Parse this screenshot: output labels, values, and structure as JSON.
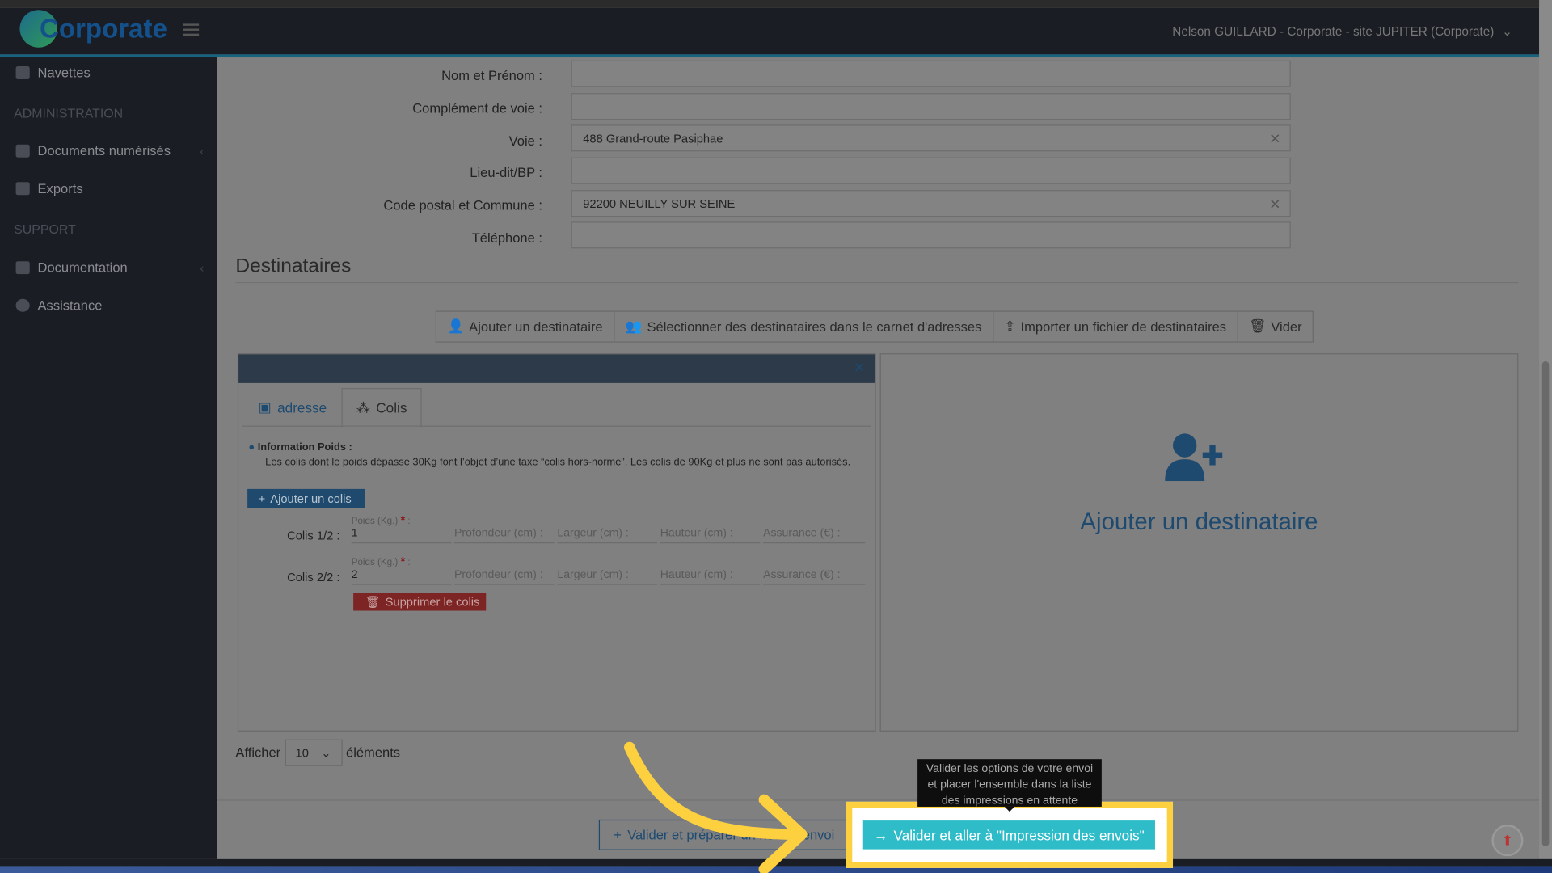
{
  "header": {
    "logo_text": "Corporate",
    "user": "Nelson GUILLARD - Corporate - site JUPITER (Corporate)"
  },
  "sidebar": {
    "items": [
      {
        "label": "Navettes",
        "icon": "truck-icon"
      },
      {
        "label": "Documents numérisés",
        "icon": "qrcode-icon"
      },
      {
        "label": "Exports",
        "icon": "download-icon"
      },
      {
        "label": "Documentation",
        "icon": "book-icon"
      },
      {
        "label": "Assistance",
        "icon": "question-icon"
      }
    ],
    "sections": [
      "ADMINISTRATION",
      "SUPPORT"
    ]
  },
  "form": {
    "fields": [
      {
        "label": "Nom et Prénom :",
        "value": ""
      },
      {
        "label": "Complément de voie :",
        "value": ""
      },
      {
        "label": "Voie :",
        "value": "488 Grand-route Pasiphae"
      },
      {
        "label": "Lieu-dit/BP :",
        "value": ""
      },
      {
        "label": "Code postal et Commune :",
        "value": "92200 NEUILLY SUR SEINE"
      },
      {
        "label": "Téléphone :",
        "value": ""
      }
    ]
  },
  "destinataires": {
    "title": "Destinataires",
    "buttons": [
      "Ajouter un destinataire",
      "Sélectionner des destinataires dans le carnet d'adresses",
      "Importer un fichier de destinataires",
      "Vider"
    ],
    "tabs": [
      "adresse",
      "Colis"
    ],
    "info_title": "Information Poids :",
    "info_text": "Les colis dont le poids dépasse 30Kg font l’objet d’une taxe “colis hors-norme”. Les colis de 90Kg et plus ne sont pas autorisés.",
    "add_colis": "Ajouter un colis",
    "poids_label": "Poids (Kg.)",
    "required_mark": "*",
    "colon": ":",
    "colis": [
      {
        "name": "Colis 1/2 :",
        "poids": "1"
      },
      {
        "name": "Colis 2/2 :",
        "poids": "2"
      }
    ],
    "dim_placeholders": [
      "Profondeur (cm) :",
      "Largeur (cm) :",
      "Hauteur (cm) :",
      "Assurance (€) :"
    ],
    "delete_colis": "Supprimer le colis",
    "add_recipient_panel": "Ajouter un destinataire"
  },
  "pagination": {
    "show": "Afficher",
    "value": "10",
    "elements": "éléments"
  },
  "footer": {
    "prepare_button": "Valider et préparer un nouvel envoi",
    "go_button": "Valider et aller à \"Impression des envois\"",
    "tooltip": "Valider les options de votre envoi et placer l'ensemble dans la liste des impressions en attente"
  },
  "colors": {
    "highlight": "#fdd040",
    "go_button": "#2fbcc9",
    "primary": "#1e4a70",
    "danger": "#7d2424"
  }
}
